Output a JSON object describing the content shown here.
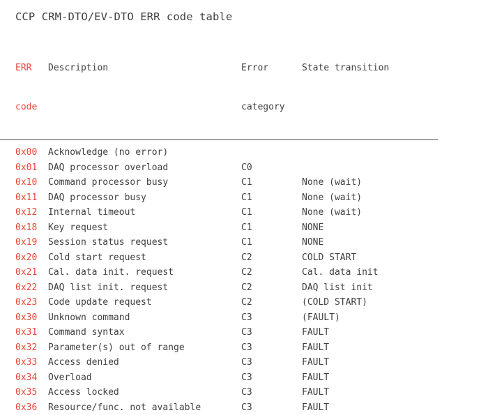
{
  "document": {
    "title": "CCP CRM-DTO/EV-DTO ERR code table"
  },
  "colors": {
    "header_blue": "#3f7fc1",
    "code_red": "#e8463c",
    "body_text": "#3f3f3f",
    "rule": "#4a4a4a",
    "background": "#ffffff"
  },
  "table": {
    "headers": {
      "err_code": {
        "line1": "ERR",
        "line2": "code"
      },
      "description": {
        "line1": "Description",
        "line2": ""
      },
      "error_category": {
        "line1": "Error",
        "line2": "category"
      },
      "state_transition": {
        "line1": "State transition",
        "line2": ""
      }
    },
    "rows": [
      {
        "code": "0x00",
        "description": "Acknowledge (no error)",
        "category": "",
        "state": ""
      },
      {
        "code": "0x01",
        "description": "DAQ processor overload",
        "category": "C0",
        "state": ""
      },
      {
        "code": "0x10",
        "description": "Command processor busy",
        "category": "C1",
        "state": "None (wait)"
      },
      {
        "code": "0x11",
        "description": "DAQ processor busy",
        "category": "C1",
        "state": "None (wait)"
      },
      {
        "code": "0x12",
        "description": "Internal timeout",
        "category": "C1",
        "state": "None (wait)"
      },
      {
        "code": "0x18",
        "description": "Key request",
        "category": "C1",
        "state": "NONE"
      },
      {
        "code": "0x19",
        "description": "Session status request",
        "category": "C1",
        "state": "NONE"
      },
      {
        "code": "0x20",
        "description": "Cold start request",
        "category": "C2",
        "state": "COLD START"
      },
      {
        "code": "0x21",
        "description": "Cal. data init. request",
        "category": "C2",
        "state": "Cal. data init"
      },
      {
        "code": "0x22",
        "description": "DAQ list init. request",
        "category": "C2",
        "state": "DAQ list init"
      },
      {
        "code": "0x23",
        "description": "Code update request",
        "category": "C2",
        "state": "(COLD START)"
      },
      {
        "code": "0x30",
        "description": "Unknown command",
        "category": "C3",
        "state": "(FAULT)"
      },
      {
        "code": "0x31",
        "description": "Command syntax",
        "category": "C3",
        "state": "FAULT"
      },
      {
        "code": "0x32",
        "description": "Parameter(s) out of range",
        "category": "C3",
        "state": "FAULT"
      },
      {
        "code": "0x33",
        "description": "Access denied",
        "category": "C3",
        "state": "FAULT"
      },
      {
        "code": "0x34",
        "description": "Overload",
        "category": "C3",
        "state": "FAULT"
      },
      {
        "code": "0x35",
        "description": "Access locked",
        "category": "C3",
        "state": "FAULT"
      },
      {
        "code": "0x36",
        "description": "Resource/func. not available",
        "category": "C3",
        "state": "FAULT"
      }
    ]
  }
}
